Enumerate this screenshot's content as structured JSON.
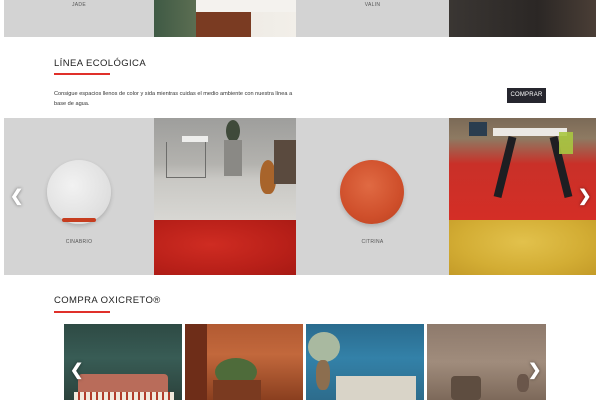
{
  "top_carousel": {
    "labels": [
      "JADE",
      "VALIN"
    ]
  },
  "eco_line": {
    "title": "LÍNEA ECOLÓGICA",
    "description": "Consigue espacios llenos de color y sida mientras cuidas el medio ambiente con nuestra línea a base de agua.",
    "buy_label": "COMPRAR",
    "swatches": [
      {
        "label": "CINABRIO",
        "color": "#e2e2e2"
      },
      {
        "label": "CITRINA",
        "color": "#cf4f2b"
      }
    ],
    "prev_icon": "chevron-left-icon",
    "next_icon": "chevron-right-icon"
  },
  "buy_section": {
    "title": "COMPRA OXICRETO®",
    "prev_icon": "chevron-left-icon",
    "next_icon": "chevron-right-icon"
  },
  "colors": {
    "accent": "#e0302a",
    "button_bg": "#26262e",
    "swatch_bg": "#d4d4d4"
  },
  "glyphs": {
    "left": "❮",
    "right": "❯"
  }
}
